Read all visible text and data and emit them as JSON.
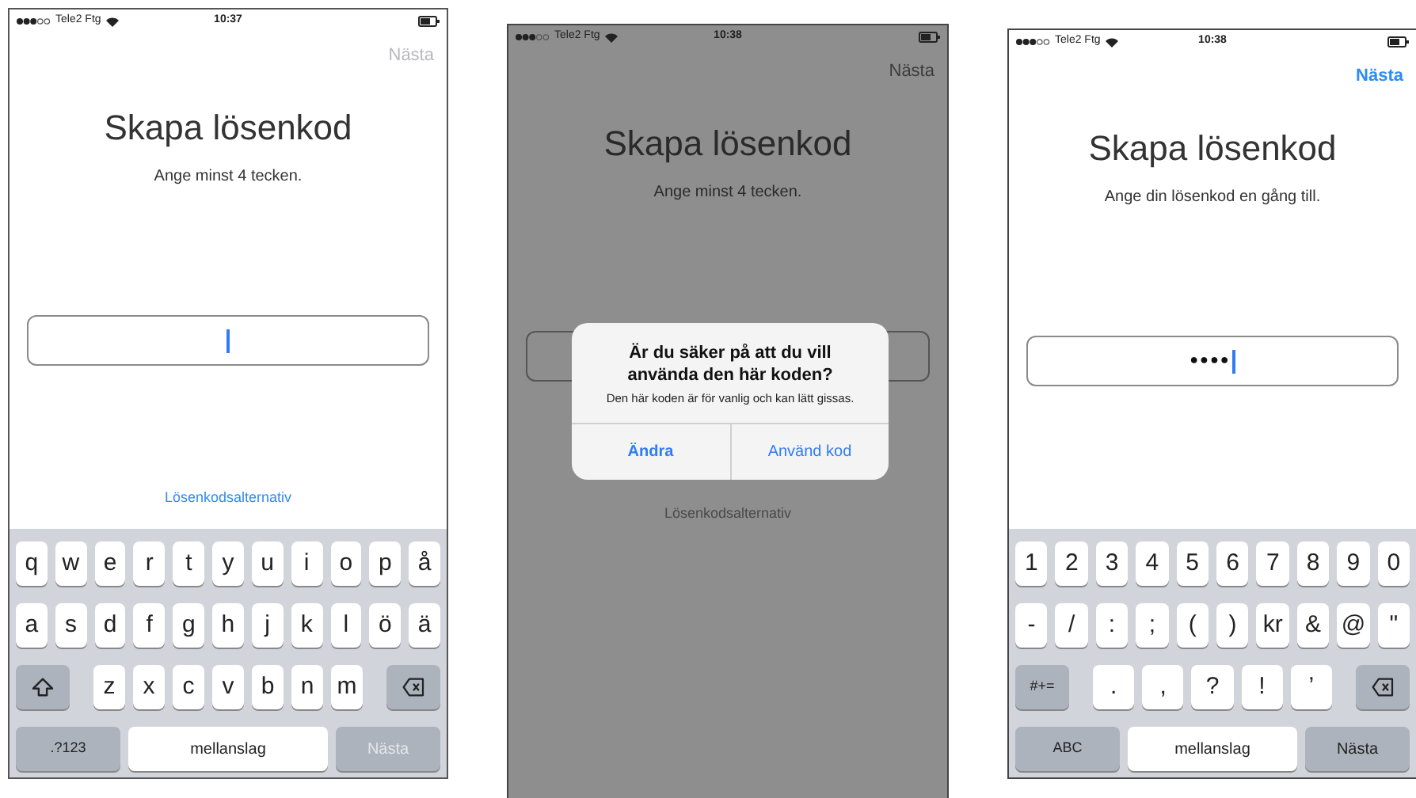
{
  "screens": [
    {
      "dimmed": false,
      "status": {
        "carrier": "Tele2 Ftg",
        "time": "10:37"
      },
      "next": {
        "label": "Nästa",
        "disabled": true
      },
      "title": "Skapa lösenkod",
      "subtitle": "Ange minst 4 tecken.",
      "field": {
        "focused": true
      },
      "link": "Lösenkodsalternativ",
      "keyboard": {
        "rows": [
          {
            "keys": [
              {
                "kind": "char",
                "label": "q"
              },
              {
                "kind": "char",
                "label": "w"
              },
              {
                "kind": "char",
                "label": "e"
              },
              {
                "kind": "char",
                "label": "r"
              },
              {
                "kind": "char",
                "label": "t"
              },
              {
                "kind": "char",
                "label": "y"
              },
              {
                "kind": "char",
                "label": "u"
              },
              {
                "kind": "char",
                "label": "i"
              },
              {
                "kind": "char",
                "label": "o"
              },
              {
                "kind": "char",
                "label": "p"
              },
              {
                "kind": "char",
                "label": "å"
              }
            ]
          },
          {
            "keys": [
              {
                "kind": "char",
                "label": "a"
              },
              {
                "kind": "char",
                "label": "s"
              },
              {
                "kind": "char",
                "label": "d"
              },
              {
                "kind": "char",
                "label": "f"
              },
              {
                "kind": "char",
                "label": "g"
              },
              {
                "kind": "char",
                "label": "h"
              },
              {
                "kind": "char",
                "label": "j"
              },
              {
                "kind": "char",
                "label": "k"
              },
              {
                "kind": "char",
                "label": "l"
              },
              {
                "kind": "char",
                "label": "ö"
              },
              {
                "kind": "char",
                "label": "ä"
              }
            ]
          },
          {
            "keys": [
              {
                "kind": "shift"
              },
              {
                "kind": "char",
                "label": "z"
              },
              {
                "kind": "char",
                "label": "x"
              },
              {
                "kind": "char",
                "label": "c"
              },
              {
                "kind": "char",
                "label": "v"
              },
              {
                "kind": "char",
                "label": "b"
              },
              {
                "kind": "char",
                "label": "n"
              },
              {
                "kind": "char",
                "label": "m"
              },
              {
                "kind": "delete"
              }
            ]
          },
          {
            "keys": [
              {
                "kind": "mode",
                "label": ".?123"
              },
              {
                "kind": "space",
                "label": "mellanslag"
              },
              {
                "kind": "return",
                "label": "Nästa",
                "disabled": true
              }
            ]
          }
        ]
      }
    },
    {
      "dimmed": true,
      "status": {
        "carrier": "Tele2 Ftg",
        "time": "10:38"
      },
      "next": {
        "label": "Nästa",
        "disabled": true
      },
      "title": "Skapa lösenkod",
      "subtitle": "Ange minst 4 tecken.",
      "link": "Lösenkodsalternativ",
      "alert": {
        "title": "Är du säker på att du vill använda den här koden?",
        "message": "Den här koden är för vanlig och kan lätt gissas.",
        "buttons": [
          {
            "label": "Ändra",
            "primary": true
          },
          {
            "label": "Använd kod",
            "primary": false
          }
        ]
      }
    },
    {
      "dimmed": false,
      "status": {
        "carrier": "Tele2 Ftg",
        "time": "10:38"
      },
      "next": {
        "label": "Nästa",
        "disabled": false
      },
      "title": "Skapa lösenkod",
      "subtitle": "Ange din lösenkod en gång till.",
      "field": {
        "value": "●●●●",
        "focused": true
      },
      "keyboard": {
        "rows": [
          {
            "keys": [
              {
                "kind": "char",
                "label": "1"
              },
              {
                "kind": "char",
                "label": "2"
              },
              {
                "kind": "char",
                "label": "3"
              },
              {
                "kind": "char",
                "label": "4"
              },
              {
                "kind": "char",
                "label": "5"
              },
              {
                "kind": "char",
                "label": "6"
              },
              {
                "kind": "char",
                "label": "7"
              },
              {
                "kind": "char",
                "label": "8"
              },
              {
                "kind": "char",
                "label": "9"
              },
              {
                "kind": "char",
                "label": "0"
              }
            ]
          },
          {
            "keys": [
              {
                "kind": "char",
                "label": "-"
              },
              {
                "kind": "char",
                "label": "/"
              },
              {
                "kind": "char",
                "label": ":"
              },
              {
                "kind": "char",
                "label": ";"
              },
              {
                "kind": "char",
                "label": "("
              },
              {
                "kind": "char",
                "label": ")"
              },
              {
                "kind": "char",
                "label": "kr"
              },
              {
                "kind": "char",
                "label": "&"
              },
              {
                "kind": "char",
                "label": "@"
              },
              {
                "kind": "char",
                "label": "\""
              }
            ]
          },
          {
            "keys": [
              {
                "kind": "mode",
                "label": "#+="
              },
              {
                "kind": "char",
                "label": "."
              },
              {
                "kind": "char",
                "label": ","
              },
              {
                "kind": "char",
                "label": "?"
              },
              {
                "kind": "char",
                "label": "!"
              },
              {
                "kind": "char",
                "label": "’"
              },
              {
                "kind": "delete"
              }
            ]
          },
          {
            "keys": [
              {
                "kind": "mode",
                "label": "ABC"
              },
              {
                "kind": "space",
                "label": "mellanslag"
              },
              {
                "kind": "return",
                "label": "Nästa",
                "disabled": false
              }
            ]
          }
        ]
      }
    }
  ]
}
